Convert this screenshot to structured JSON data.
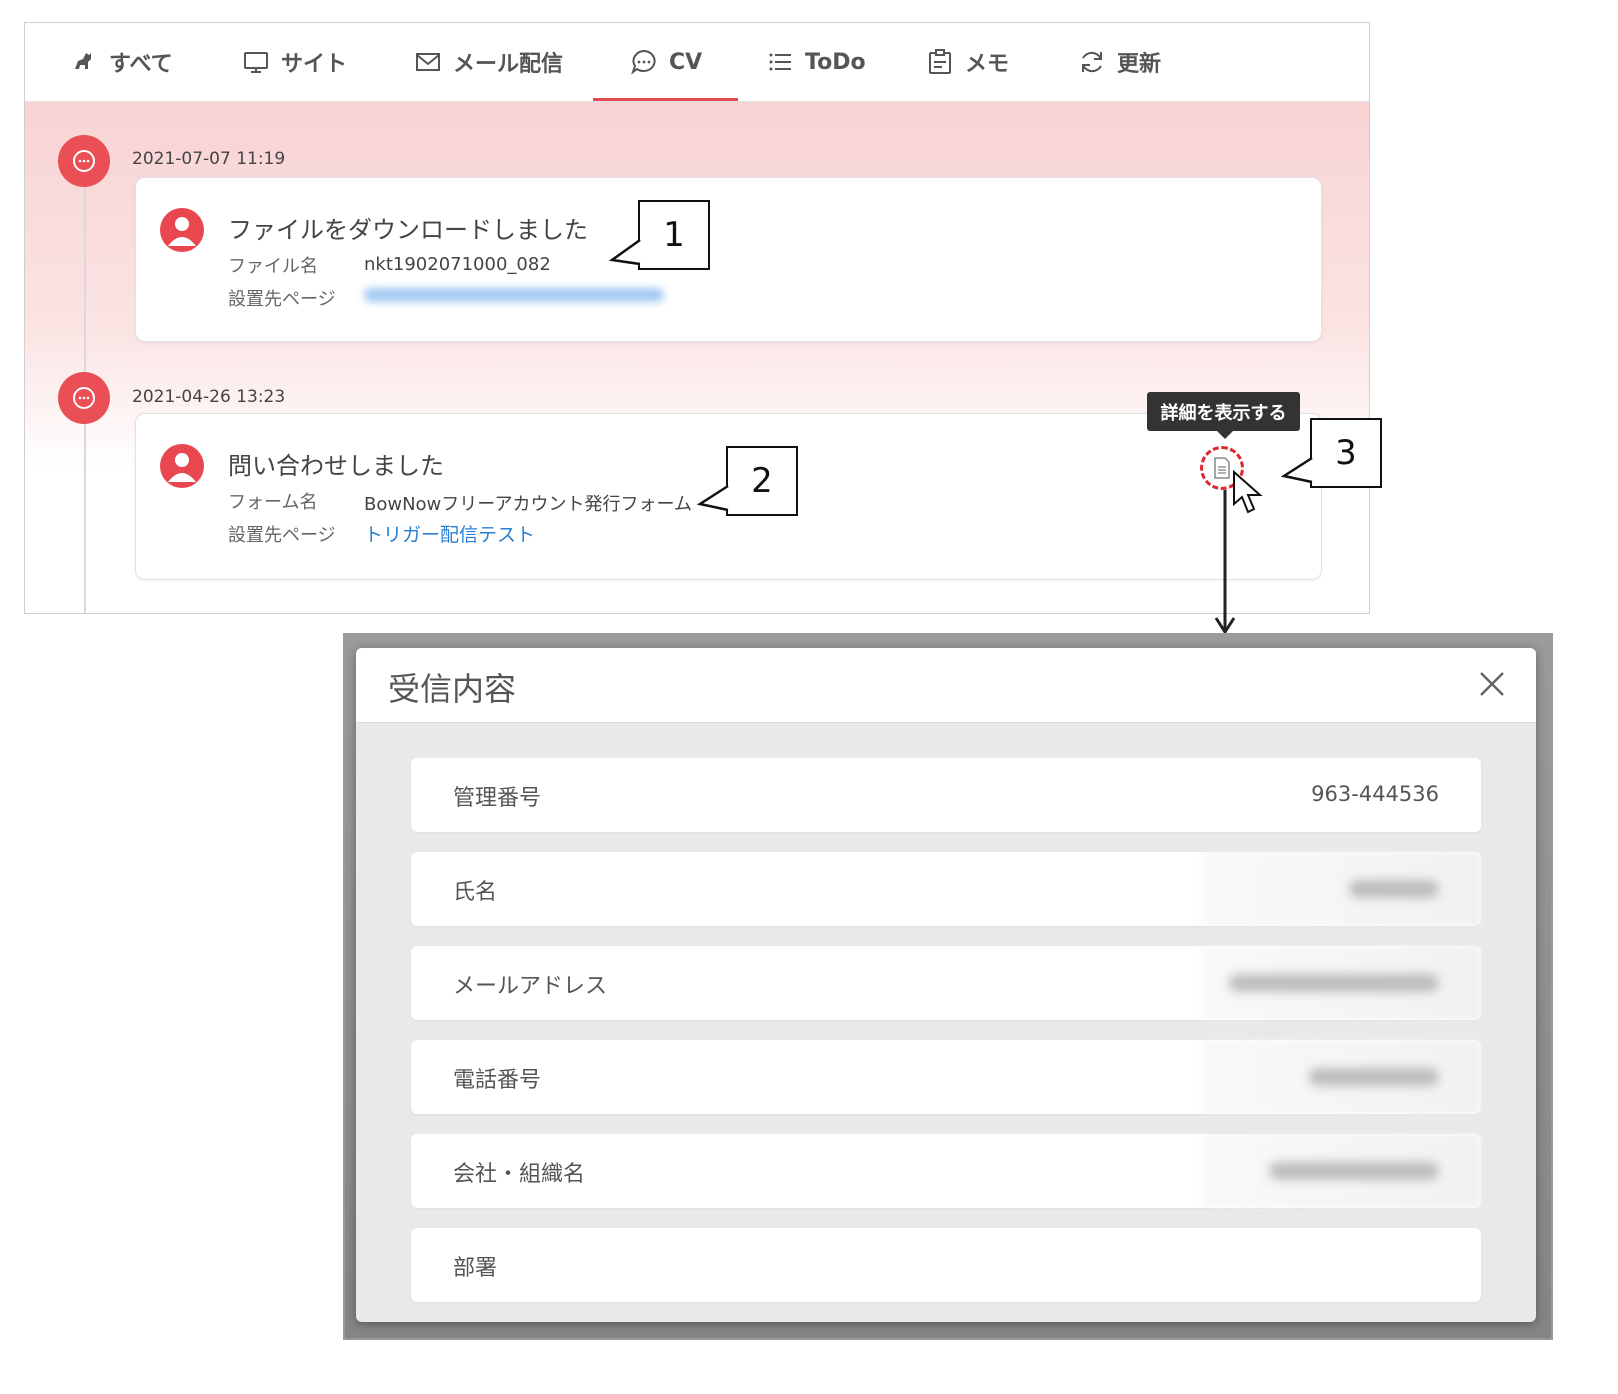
{
  "tabs": [
    {
      "label": "すべて",
      "icon": "dog-icon"
    },
    {
      "label": "サイト",
      "icon": "monitor-icon"
    },
    {
      "label": "メール配信",
      "icon": "mail-icon"
    },
    {
      "label": "CV",
      "icon": "chat-bubble-icon"
    },
    {
      "label": "ToDo",
      "icon": "list-icon"
    },
    {
      "label": "メモ",
      "icon": "clipboard-icon"
    },
    {
      "label": "更新",
      "icon": "refresh-icon"
    }
  ],
  "active_tab": "CV",
  "timeline": [
    {
      "date": "2021-07-07 11:19",
      "title": "ファイルをダウンロードしました",
      "field1_label": "ファイル名",
      "field1_value": "nkt1902071000_082",
      "field2_label": "設置先ページ"
    },
    {
      "date": "2021-04-26 13:23",
      "title": "問い合わせしました",
      "field1_label": "フォーム名",
      "field1_value": "BowNowフリーアカウント発行フォーム",
      "field2_label": "設置先ページ",
      "field2_value": "トリガー配信テスト"
    }
  ],
  "callouts": [
    "1",
    "2",
    "3"
  ],
  "tooltip": "詳細を表示する",
  "modal": {
    "title": "受信内容",
    "rows": [
      {
        "label": "管理番号",
        "value": "963-444536"
      },
      {
        "label": "氏名"
      },
      {
        "label": "メールアドレス"
      },
      {
        "label": "電話番号"
      },
      {
        "label": "会社・組織名"
      },
      {
        "label": "部署"
      }
    ]
  },
  "colors": {
    "accent": "#e9474f",
    "link": "#2a7fd4",
    "tooltip_bg": "#333333"
  }
}
